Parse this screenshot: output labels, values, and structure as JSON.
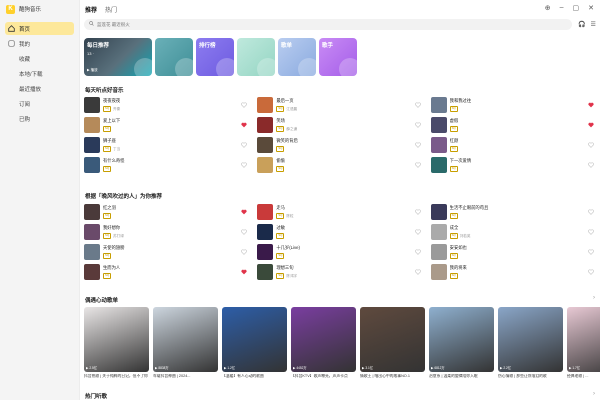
{
  "sidebar": {
    "brand": "酷狗音乐",
    "items": [
      {
        "label": "首页",
        "icon": "home-icon",
        "active": true
      },
      {
        "label": "我的",
        "icon": "user-icon",
        "active": false
      },
      {
        "label": "收藏",
        "icon": "",
        "active": false
      },
      {
        "label": "本地/下载",
        "icon": "",
        "active": false
      },
      {
        "label": "最近播放",
        "icon": "",
        "active": false
      },
      {
        "label": "订阅",
        "icon": "",
        "active": false
      },
      {
        "label": "已购",
        "icon": "",
        "active": false
      }
    ]
  },
  "topbar": {
    "tabs": [
      {
        "label": "推荐",
        "active": true
      },
      {
        "label": "热门",
        "active": false
      }
    ]
  },
  "search": {
    "placeholder": "蓝莲花 最近很火"
  },
  "cards": [
    {
      "title": "每日推荐",
      "sub": "13 ·",
      "play": "▶ 播放",
      "type": "daily",
      "color": "#3b5561"
    },
    {
      "title": "排行榜",
      "color": "#6c5ce7"
    },
    {
      "title": "",
      "color": "#aee6da"
    },
    {
      "title": "歌单",
      "color": "#9bb8e8"
    },
    {
      "title": "歌手",
      "color": "#b36cf0"
    }
  ],
  "daily_section": {
    "title": "每天听点好音乐"
  },
  "daily_songs": [
    {
      "title": "夜夜夜夜",
      "artist": "齐秦",
      "liked": false,
      "color": "#3a3a3a"
    },
    {
      "title": "最后一页",
      "artist": "江语晨",
      "liked": false,
      "color": "#c96a3a"
    },
    {
      "title": "我和我过往",
      "artist": "",
      "liked": true,
      "color": "#6a7a90"
    },
    {
      "title": "爱上以下",
      "artist": "",
      "liked": true,
      "color": "#b58a5a"
    },
    {
      "title": "笑场",
      "artist": "薛之谦",
      "liked": false,
      "color": "#8a2a2a"
    },
    {
      "title": "虚假",
      "artist": "",
      "liked": true,
      "color": "#4a4a6a"
    },
    {
      "title": "狮子座",
      "artist": "丁当",
      "liked": false,
      "color": "#2a3a5a"
    },
    {
      "title": "微笑的背后",
      "artist": "",
      "liked": false,
      "color": "#5a4a3a"
    },
    {
      "title": "红颜",
      "artist": "",
      "liked": false,
      "color": "#7a5a8a"
    },
    {
      "title": "有什么奇怪",
      "artist": "",
      "liked": false,
      "color": "#3a5a7a"
    },
    {
      "title": "偷偷",
      "artist": "",
      "liked": false,
      "color": "#c9a05a"
    },
    {
      "title": "下一次爱情",
      "artist": "",
      "liked": false,
      "color": "#2a6a6a"
    }
  ],
  "rec_section": {
    "title": "根据「晚风吹过的人」为你推荐"
  },
  "rec_songs": [
    {
      "title": "红之羽",
      "artist": "",
      "liked": true,
      "color": "#4a3a3a"
    },
    {
      "title": "走马",
      "artist": "陈粒",
      "liked": false,
      "color": "#c93a3a"
    },
    {
      "title": "生活不止眼前的苟且",
      "artist": "",
      "liked": false,
      "color": "#3a3a5a"
    },
    {
      "title": "我好想你",
      "artist": "苏打绿",
      "liked": false,
      "color": "#6a4a6a"
    },
    {
      "title": "过敏",
      "artist": "",
      "liked": false,
      "color": "#1a2a4a"
    },
    {
      "title": "成全",
      "artist": "刘若英",
      "liked": false,
      "color": "#aaaaaa"
    },
    {
      "title": "天使的翅膀",
      "artist": "",
      "liked": false,
      "color": "#6a7a8a"
    },
    {
      "title": "十几岁(Live)",
      "artist": "",
      "liked": false,
      "color": "#3a1a4a"
    },
    {
      "title": "安安如也",
      "artist": "",
      "liked": false,
      "color": "#9a9a9a"
    },
    {
      "title": "生而为人",
      "artist": "",
      "liked": true,
      "color": "#5a3a3a"
    },
    {
      "title": "理想三旬",
      "artist": "陈鸿宇",
      "liked": false,
      "color": "#3a4a3a"
    },
    {
      "title": "我的将来",
      "artist": "",
      "liked": false,
      "color": "#aa9a8a"
    }
  ],
  "playlist_section": {
    "title": "偶遇心动歌单"
  },
  "playlists": [
    {
      "title": "抖音热歌 | 关于纯粹的日记，但不了你",
      "count": "▶ 2.5亿",
      "color": "#e9e6e6"
    },
    {
      "title": "车载抖音神曲 | 2024...",
      "count": "▶ 8838万",
      "color": "#cdd6df"
    },
    {
      "title": "【温暖】有人心动的歌曲",
      "count": "▶ 1.2亿",
      "color": "#2d5ea8"
    },
    {
      "title": "【抖音KTV】歌声嘹亮，声声卡点",
      "count": "▶ 4452万",
      "color": "#7a3ea0"
    },
    {
      "title": "情歌王 | 唱出心中的故事NO.1",
      "count": "▶ 3.1亿",
      "color": "#5f4a3e"
    },
    {
      "title": "治愈系 | 温柔的旋律陪你入眠",
      "count": "▶ 6812万",
      "color": "#8fb0cf"
    },
    {
      "title": "伤心情歌 | 那些让你落泪的歌",
      "count": "▶ 2.2亿",
      "color": "#8aa6c8"
    },
    {
      "title": "经典老歌 | ...",
      "count": "▶ 1.7亿",
      "color": "#e8c9d4"
    }
  ],
  "hot_section": {
    "title": "热门听歌"
  }
}
